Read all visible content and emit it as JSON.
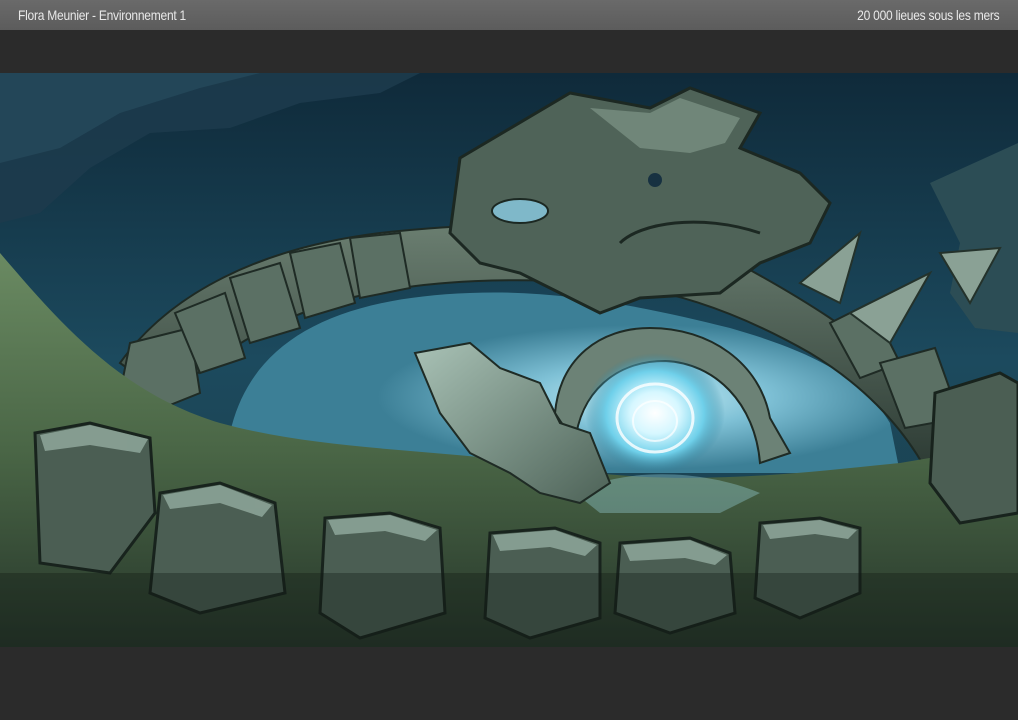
{
  "header": {
    "left_title": "Flora Meunier - Environnement 1",
    "right_title": "20 000 lieues sous les mers"
  },
  "artwork": {
    "subject": "painted-underwater-ruins-environment",
    "palette": {
      "water_dark": "#163447",
      "water_light": "#8fd2e6",
      "portal_glow": "#e6fbff",
      "stone": "#6f8074",
      "stone_dark": "#2f3d36",
      "seafloor": "#4f6a4a"
    }
  }
}
